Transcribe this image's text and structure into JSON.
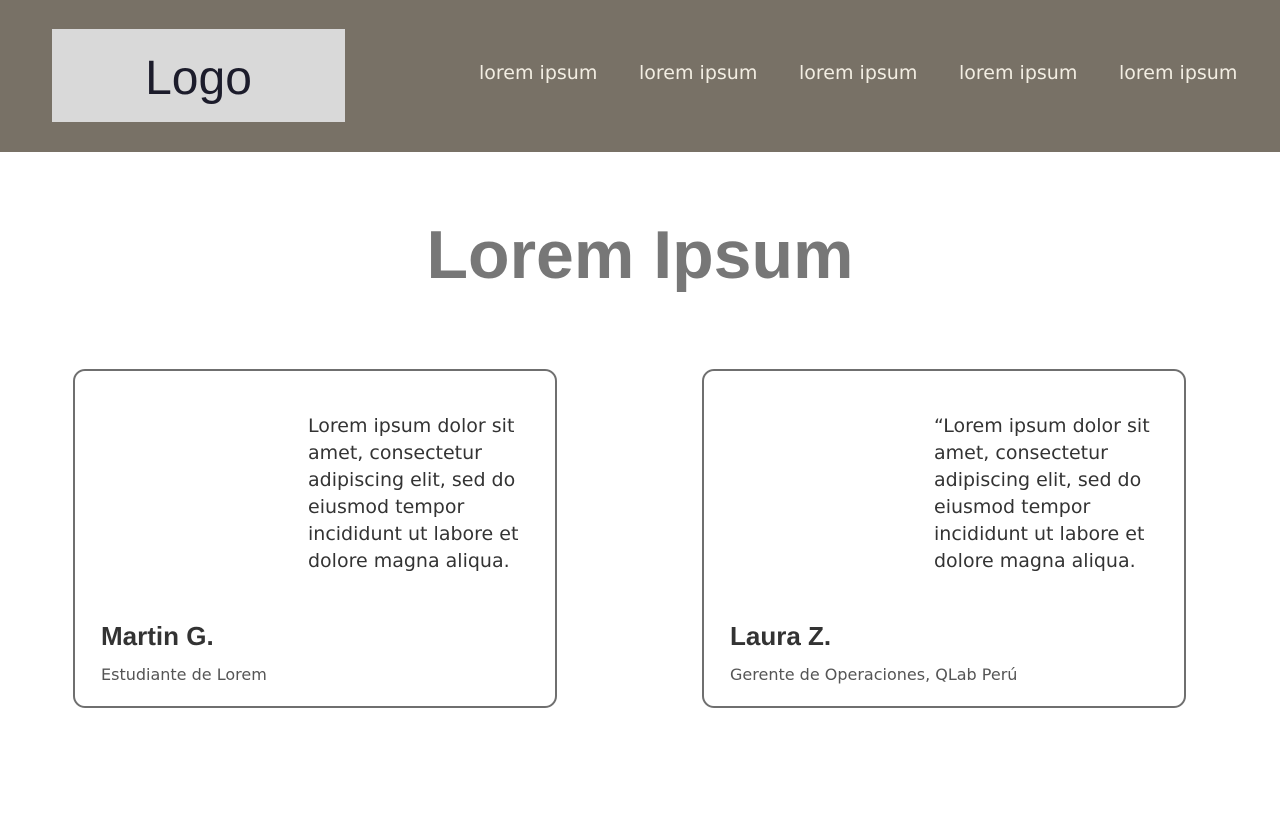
{
  "header": {
    "logo_text": "Logo",
    "nav": [
      "lorem ipsum",
      "lorem ipsum",
      "lorem ipsum",
      "lorem ipsum",
      "lorem ipsum"
    ],
    "background_color": "#787166"
  },
  "main": {
    "title": "Lorem Ipsum",
    "testimonials": [
      {
        "quote": "Lorem ipsum dolor sit amet, consectetur adipiscing elit, sed do eiusmod tempor incididunt ut labore et dolore magna aliqua.",
        "name": "Martin G.",
        "role": "Estudiante de Lorem"
      },
      {
        "quote": "“Lorem ipsum dolor sit amet, consectetur adipiscing elit, sed do eiusmod tempor incididunt ut labore et dolore magna aliqua.",
        "name": "Laura Z.",
        "role": "Gerente de Operaciones, QLab Perú"
      }
    ]
  }
}
